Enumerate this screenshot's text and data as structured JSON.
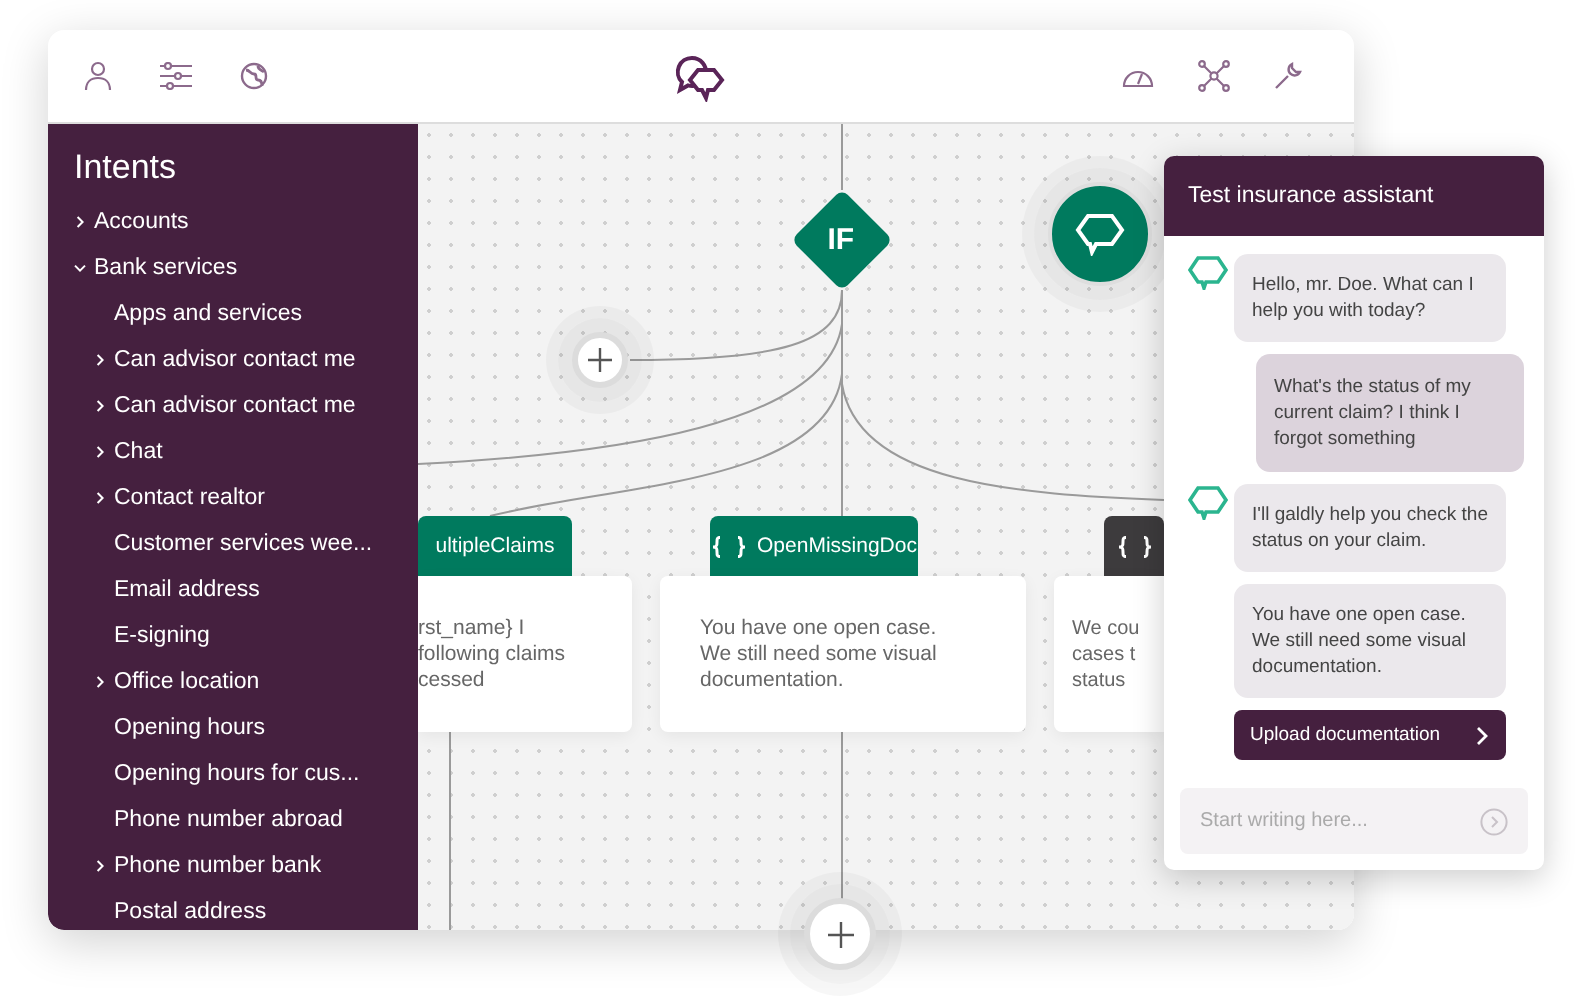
{
  "sidebar": {
    "title": "Intents",
    "items": [
      {
        "label": "Accounts",
        "kind": "group",
        "expanded": false
      },
      {
        "label": "Bank services",
        "kind": "group",
        "expanded": true,
        "children": [
          {
            "label": "Apps and services",
            "kind": "leaf"
          },
          {
            "label": "Can advisor contact me",
            "kind": "group",
            "expanded": false
          },
          {
            "label": "Can advisor contact me",
            "kind": "group",
            "expanded": false
          },
          {
            "label": "Chat",
            "kind": "group",
            "expanded": false
          },
          {
            "label": "Contact realtor",
            "kind": "group",
            "expanded": false
          },
          {
            "label": "Customer services wee...",
            "kind": "leaf"
          },
          {
            "label": "Email address",
            "kind": "leaf"
          },
          {
            "label": "E-signing",
            "kind": "leaf"
          },
          {
            "label": "Office location",
            "kind": "group",
            "expanded": false
          },
          {
            "label": "Opening hours",
            "kind": "leaf"
          },
          {
            "label": "Opening hours for cus...",
            "kind": "leaf"
          },
          {
            "label": "Phone number abroad",
            "kind": "leaf"
          },
          {
            "label": "Phone number bank",
            "kind": "group",
            "expanded": false
          },
          {
            "label": "Postal address",
            "kind": "leaf"
          }
        ]
      }
    ]
  },
  "flow": {
    "condition": "IF",
    "cards": [
      {
        "title": "ultipleClaims",
        "show_braces": false,
        "color": "#007a5e",
        "lines": [
          "rst_name} I",
          "following claims",
          "cessed"
        ]
      },
      {
        "title": "OpenMissingDoc",
        "show_braces": true,
        "color": "#007a5e",
        "lines": [
          "You have one open case.",
          "We still need some visual",
          "documentation."
        ]
      },
      {
        "show_braces": true,
        "color": "#3d3b3d",
        "lines": [
          "We cou",
          "cases t",
          "status"
        ]
      }
    ]
  },
  "chat": {
    "title": "Test insurance assistant",
    "messages": [
      {
        "kind": "bot",
        "avatar": true,
        "text": "Hello, mr. Doe. What can I help you with today?"
      },
      {
        "kind": "user",
        "avatar": false,
        "text": "What's the status of my current claim? I think I forgot something"
      },
      {
        "kind": "bot",
        "avatar": true,
        "text": "I'll galdly help you check the status on your claim."
      },
      {
        "kind": "bot",
        "avatar": false,
        "text": "You have one open case. We still need some visual documentation."
      },
      {
        "kind": "action",
        "avatar": false,
        "text": "Upload documentation"
      }
    ],
    "input": {
      "placeholder": "Start writing here..."
    }
  }
}
